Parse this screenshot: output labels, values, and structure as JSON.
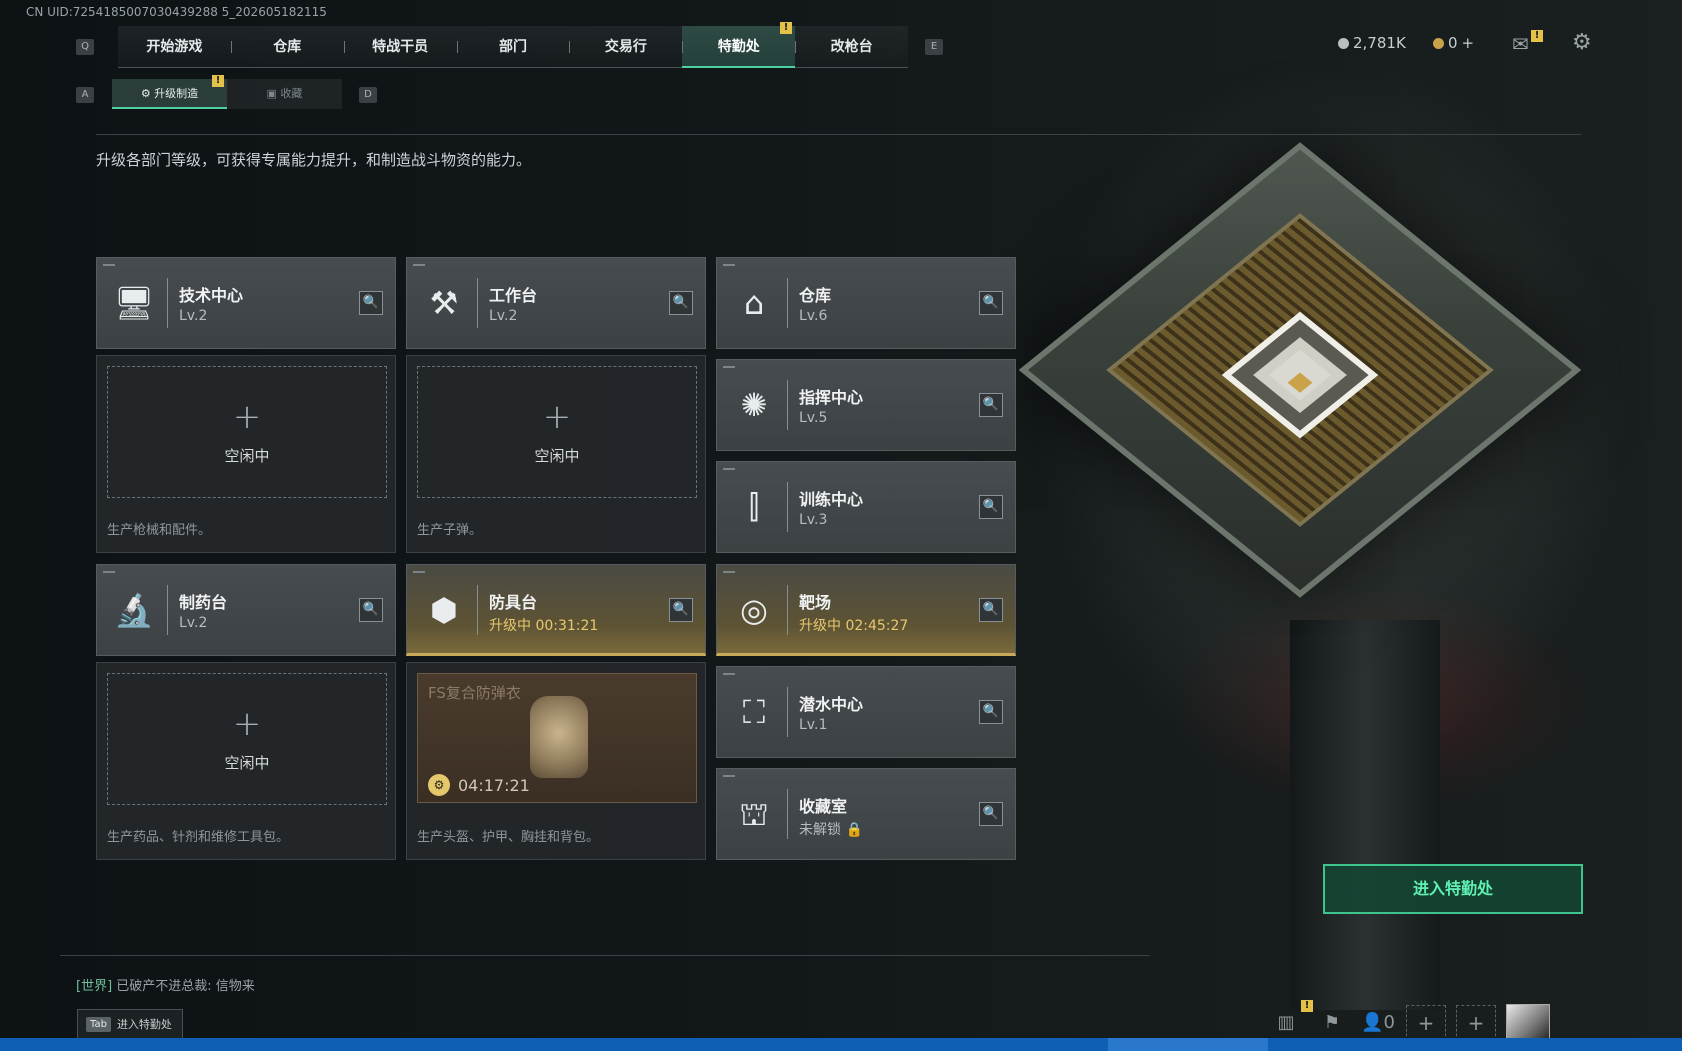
{
  "uid_text": "CN UID:7254185007030439288 5_202605182115",
  "top_nav": {
    "left_key": "Q",
    "right_key": "E",
    "tabs": [
      "开始游戏",
      "仓库",
      "特战干员",
      "部门",
      "交易行",
      "特勤处",
      "改枪台"
    ],
    "active_index": 5
  },
  "currency": {
    "silver": "2,781K",
    "gold": "0",
    "add": "+"
  },
  "sub_tabs": {
    "left_key": "A",
    "right_key": "D",
    "items": [
      "升级制造",
      "收藏"
    ],
    "active_index": 0
  },
  "description": "升级各部门等级，可获得专属能力提升，和制造战斗物资的能力。",
  "departments": [
    {
      "name": "技术中心",
      "status": "Lv.2",
      "icon": "monitor-icon"
    },
    {
      "name": "工作台",
      "status": "Lv.2",
      "icon": "tools-icon"
    },
    {
      "name": "仓库",
      "status": "Lv.6",
      "icon": "warehouse-icon"
    },
    {
      "name": "指挥中心",
      "status": "Lv.5",
      "icon": "command-icon"
    },
    {
      "name": "训练中心",
      "status": "Lv.3",
      "icon": "dumbbell-icon"
    },
    {
      "name": "制药台",
      "status": "Lv.2",
      "icon": "microscope-icon"
    },
    {
      "name": "防具台",
      "status": "升级中 00:31:21",
      "icon": "boxes-icon"
    },
    {
      "name": "靶场",
      "status": "升级中 02:45:27",
      "icon": "target-icon"
    },
    {
      "name": "潜水中心",
      "status": "Lv.1",
      "icon": "diving-mask-icon"
    },
    {
      "name": "收藏室",
      "status": "未解锁",
      "icon": "showcase-icon"
    }
  ],
  "production": {
    "idle_label": "空闲中",
    "tech_center_desc": "生产枪械和配件。",
    "workbench_desc": "生产子弹。",
    "pharmacy_desc": "生产药品、针剂和维修工具包。",
    "armor_desc": "生产头盔、护甲、胸挂和背包。",
    "armor_product_name": "FS复合防弹衣",
    "armor_product_timer": "04:17:21"
  },
  "enter_button": "进入特勤处",
  "chat": {
    "channel": "[世界]",
    "message": "已破产不进总裁: 信物来"
  },
  "tab_hint": {
    "key": "Tab",
    "label": "进入特勤处"
  },
  "friends_count": "0",
  "colors": {
    "accent_green": "#4fd0a0",
    "upgrade_gold": "#c8aa5a",
    "badge_yellow": "#e4c24a"
  }
}
